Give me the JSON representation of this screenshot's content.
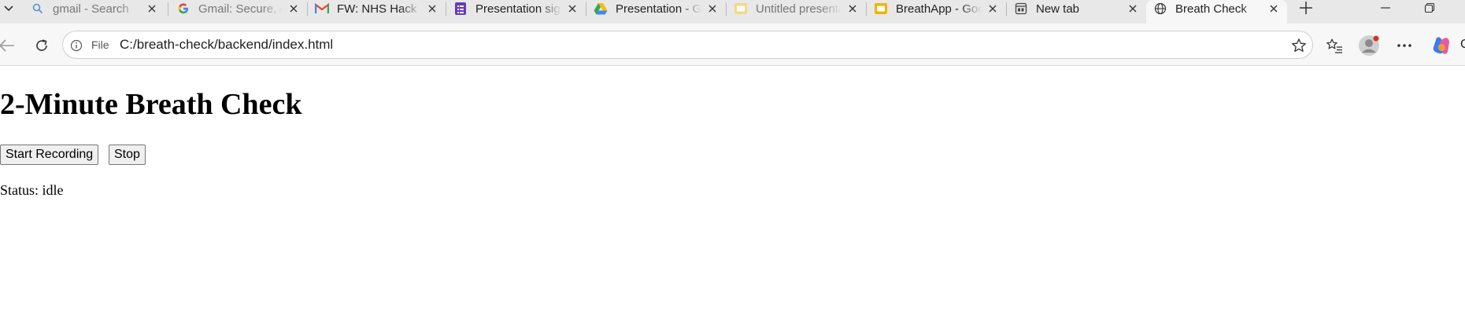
{
  "browser": {
    "tabs": [
      {
        "title": "gmail - Search",
        "icon": "search-icon",
        "dim": true,
        "active": false
      },
      {
        "title": "Gmail: Secure, AI-Powered Email",
        "icon": "google-icon",
        "dim": true,
        "active": false
      },
      {
        "title": "FW: NHS Hack Day",
        "icon": "gmail-icon",
        "dim": false,
        "active": false
      },
      {
        "title": "Presentation sign-up",
        "icon": "forms-icon",
        "dim": false,
        "active": false
      },
      {
        "title": "Presentation - Google Drive",
        "icon": "drive-icon",
        "dim": false,
        "active": false
      },
      {
        "title": "Untitled presentation",
        "icon": "slides-icon",
        "dim": true,
        "active": false
      },
      {
        "title": "BreathApp - Google Slides",
        "icon": "slides-icon",
        "dim": false,
        "active": false
      },
      {
        "title": "New tab",
        "icon": "newtab-icon",
        "dim": false,
        "active": false
      },
      {
        "title": "Breath Check",
        "icon": "globe-icon",
        "dim": false,
        "active": true
      }
    ],
    "address": {
      "scheme_label": "File",
      "url": "C:/breath-check/backend/index.html"
    },
    "copilot_label": "C",
    "colors": {
      "tabstrip": "#e8e8e8",
      "toolbar": "#f7f7f7",
      "gmail_red": "#ea4335",
      "forms_purple": "#673ab7",
      "slides_yellow": "#f4b400",
      "notification_dot": "#d93025"
    }
  },
  "page": {
    "title": "2-Minute Breath Check",
    "start_button_label": "Start Recording",
    "stop_button_label": "Stop",
    "status_text": "Status: idle"
  }
}
